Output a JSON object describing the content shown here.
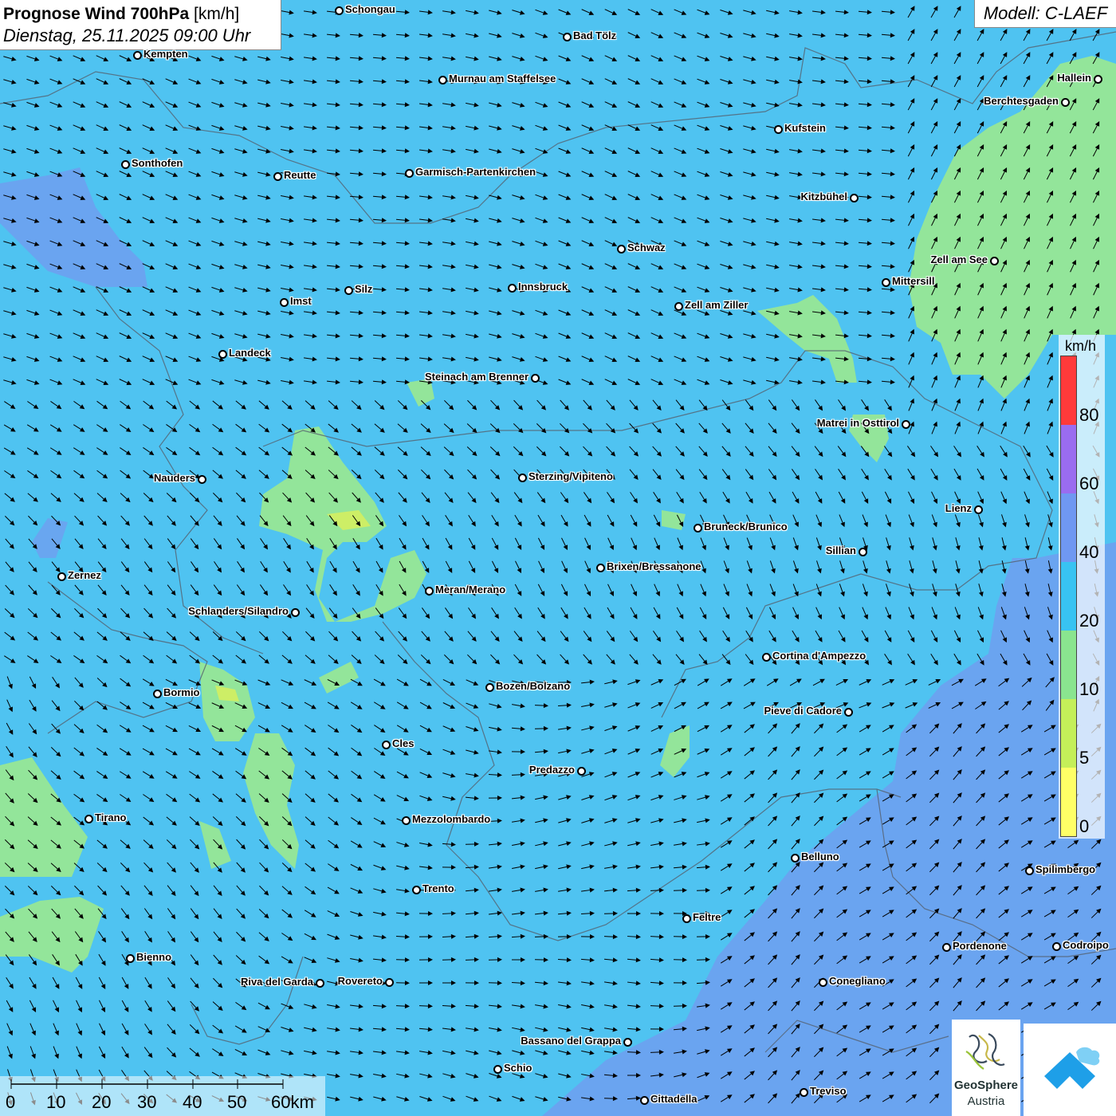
{
  "header": {
    "title_bold": "Prognose Wind 700hPa",
    "title_unit": "[km/h]",
    "datetime": "Dienstag, 25.11.2025 09:00 Uhr"
  },
  "model": "Modell: C-LAEF",
  "legend": {
    "unit": "km/h",
    "ticks": [
      "80",
      "60",
      "40",
      "20",
      "10",
      "5",
      "0"
    ],
    "colors": [
      "#ff3a3a",
      "#9a6cf0",
      "#6f98f2",
      "#38c3f2",
      "#8ae58f",
      "#c4ef59",
      "#ffff66"
    ]
  },
  "scalebar": {
    "labels": [
      "0",
      "10",
      "20",
      "30",
      "40",
      "50",
      "60km"
    ]
  },
  "logos": {
    "geosphere_line1": "GeoSphere",
    "geosphere_line2": "Austria",
    "geosphere_icon": "geosphere-logo-icon",
    "app_icon": "warnapp-cloud-icon"
  },
  "cities": [
    {
      "name": "Schongau"
    },
    {
      "name": "Bad Tölz"
    },
    {
      "name": "Kempten"
    },
    {
      "name": "Murnau am Staffelsee"
    },
    {
      "name": "Hallein"
    },
    {
      "name": "Berchtesgaden"
    },
    {
      "name": "Kufstein"
    },
    {
      "name": "Sonthofen"
    },
    {
      "name": "Reutte"
    },
    {
      "name": "Garmisch-Partenkirchen"
    },
    {
      "name": "Kitzbühel"
    },
    {
      "name": "Schwaz"
    },
    {
      "name": "Zell am See"
    },
    {
      "name": "Mittersill"
    },
    {
      "name": "Silz"
    },
    {
      "name": "Innsbruck"
    },
    {
      "name": "Imst"
    },
    {
      "name": "Zell am Ziller"
    },
    {
      "name": "Landeck"
    },
    {
      "name": "Steinach am Brenner"
    },
    {
      "name": "Matrei in Osttirol"
    },
    {
      "name": "Nauders"
    },
    {
      "name": "Sterzing/Vipiteno"
    },
    {
      "name": "Lienz"
    },
    {
      "name": "Bruneck/Brunico"
    },
    {
      "name": "Sillian"
    },
    {
      "name": "Zernez"
    },
    {
      "name": "Brixen/Bressanone"
    },
    {
      "name": "Meran/Merano"
    },
    {
      "name": "Schlanders/Silandro"
    },
    {
      "name": "Cortina d'Ampezzo"
    },
    {
      "name": "Bozen/Bolzano"
    },
    {
      "name": "Bormio"
    },
    {
      "name": "Pieve di Cadore"
    },
    {
      "name": "Cles"
    },
    {
      "name": "Predazzo"
    },
    {
      "name": "Tirano"
    },
    {
      "name": "Mezzolombardo"
    },
    {
      "name": "Belluno"
    },
    {
      "name": "Spilimbergo"
    },
    {
      "name": "Trento"
    },
    {
      "name": "Feltre"
    },
    {
      "name": "Bienno"
    },
    {
      "name": "Pordenone"
    },
    {
      "name": "Codroipo"
    },
    {
      "name": "Riva del Garda"
    },
    {
      "name": "Rovereto"
    },
    {
      "name": "Conegliano"
    },
    {
      "name": "Bassano del Grappa"
    },
    {
      "name": "Schio"
    },
    {
      "name": "Treviso"
    },
    {
      "name": "Cittadella"
    }
  ]
}
